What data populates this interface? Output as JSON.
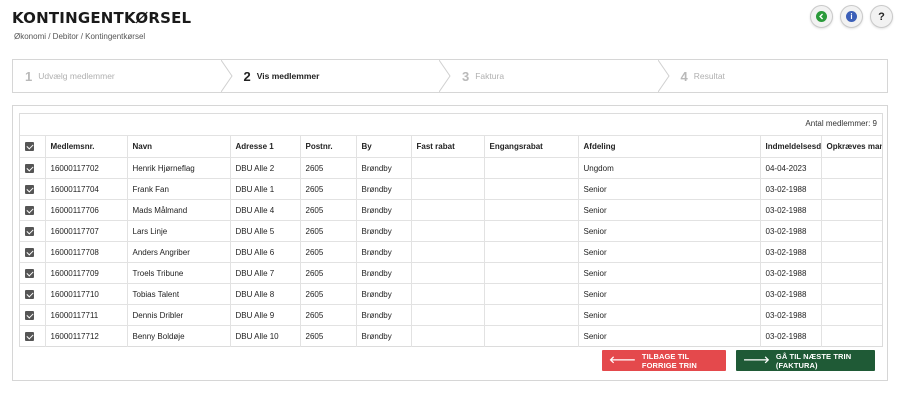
{
  "header": {
    "title": "KONTINGENTKØRSEL",
    "breadcrumb": "Økonomi / Debitor / Kontingentkørsel"
  },
  "top_icons": [
    {
      "name": "back-icon",
      "glyph": "‹",
      "color": "#2a9a3a"
    },
    {
      "name": "info-icon",
      "glyph": "i",
      "color": "#3b5fb8"
    },
    {
      "name": "help-icon",
      "glyph": "?",
      "color": "#222222"
    }
  ],
  "steps": [
    {
      "num": "1",
      "label": "Udvælg medlemmer",
      "active": false
    },
    {
      "num": "2",
      "label": "Vis medlemmer",
      "active": true
    },
    {
      "num": "3",
      "label": "Faktura",
      "active": false
    },
    {
      "num": "4",
      "label": "Resultat",
      "active": false
    }
  ],
  "table": {
    "count_text": "Antal medlemmer: 9",
    "columns": [
      "Medlemsnr.",
      "Navn",
      "Adresse 1",
      "Postnr.",
      "By",
      "Fast rabat",
      "Engangsrabat",
      "Afdeling",
      "Indmeldelsesdato",
      "Opkræves manuelt"
    ],
    "rows": [
      [
        "16000117702",
        "Henrik Hjørneflag",
        "DBU Alle 2",
        "2605",
        "Brøndby",
        "",
        "",
        "Ungdom",
        "04-04-2023",
        ""
      ],
      [
        "16000117704",
        "Frank Fan",
        "DBU Alle 1",
        "2605",
        "Brøndby",
        "",
        "",
        "Senior",
        "03-02-1988",
        ""
      ],
      [
        "16000117706",
        "Mads Målmand",
        "DBU Alle 4",
        "2605",
        "Brøndby",
        "",
        "",
        "Senior",
        "03-02-1988",
        ""
      ],
      [
        "16000117707",
        "Lars Linje",
        "DBU Alle 5",
        "2605",
        "Brøndby",
        "",
        "",
        "Senior",
        "03-02-1988",
        ""
      ],
      [
        "16000117708",
        "Anders Angriber",
        "DBU Alle 6",
        "2605",
        "Brøndby",
        "",
        "",
        "Senior",
        "03-02-1988",
        ""
      ],
      [
        "16000117709",
        "Troels Tribune",
        "DBU Alle 7",
        "2605",
        "Brøndby",
        "",
        "",
        "Senior",
        "03-02-1988",
        ""
      ],
      [
        "16000117710",
        "Tobias Talent",
        "DBU Alle 8",
        "2605",
        "Brøndby",
        "",
        "",
        "Senior",
        "03-02-1988",
        ""
      ],
      [
        "16000117711",
        "Dennis Dribler",
        "DBU Alle 9",
        "2605",
        "Brøndby",
        "",
        "",
        "Senior",
        "03-02-1988",
        ""
      ],
      [
        "16000117712",
        "Benny Boldøje",
        "DBU Alle 10",
        "2605",
        "Brøndby",
        "",
        "",
        "Senior",
        "03-02-1988",
        ""
      ]
    ]
  },
  "buttons": {
    "back_label": "TILBAGE TIL FORRIGE TRIN",
    "next_label": "GÅ TIL NÆSTE TRIN (FAKTURA)"
  },
  "colors": {
    "back_button": "#e4494c",
    "next_button": "#1f5a36"
  }
}
